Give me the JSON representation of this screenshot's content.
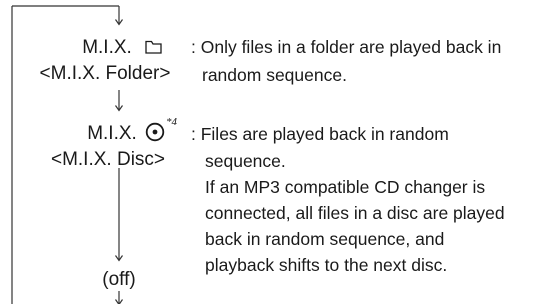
{
  "modes": [
    {
      "name": "M.I.X.",
      "icon": "folder-icon",
      "label": "<M.I.X. Folder>",
      "description": [
        ": Only files in a folder are played back in",
        "random sequence."
      ]
    },
    {
      "name": "M.I.X.",
      "icon": "disc-icon",
      "footnote": "*4",
      "label": "<M.I.X. Disc>",
      "description": [
        ": Files are played back in random",
        "sequence.",
        "If an MP3 compatible CD changer is",
        "connected, all files in a disc are played",
        "back in random sequence, and",
        "playback shifts to the next disc."
      ]
    },
    {
      "label": "(off)"
    }
  ]
}
